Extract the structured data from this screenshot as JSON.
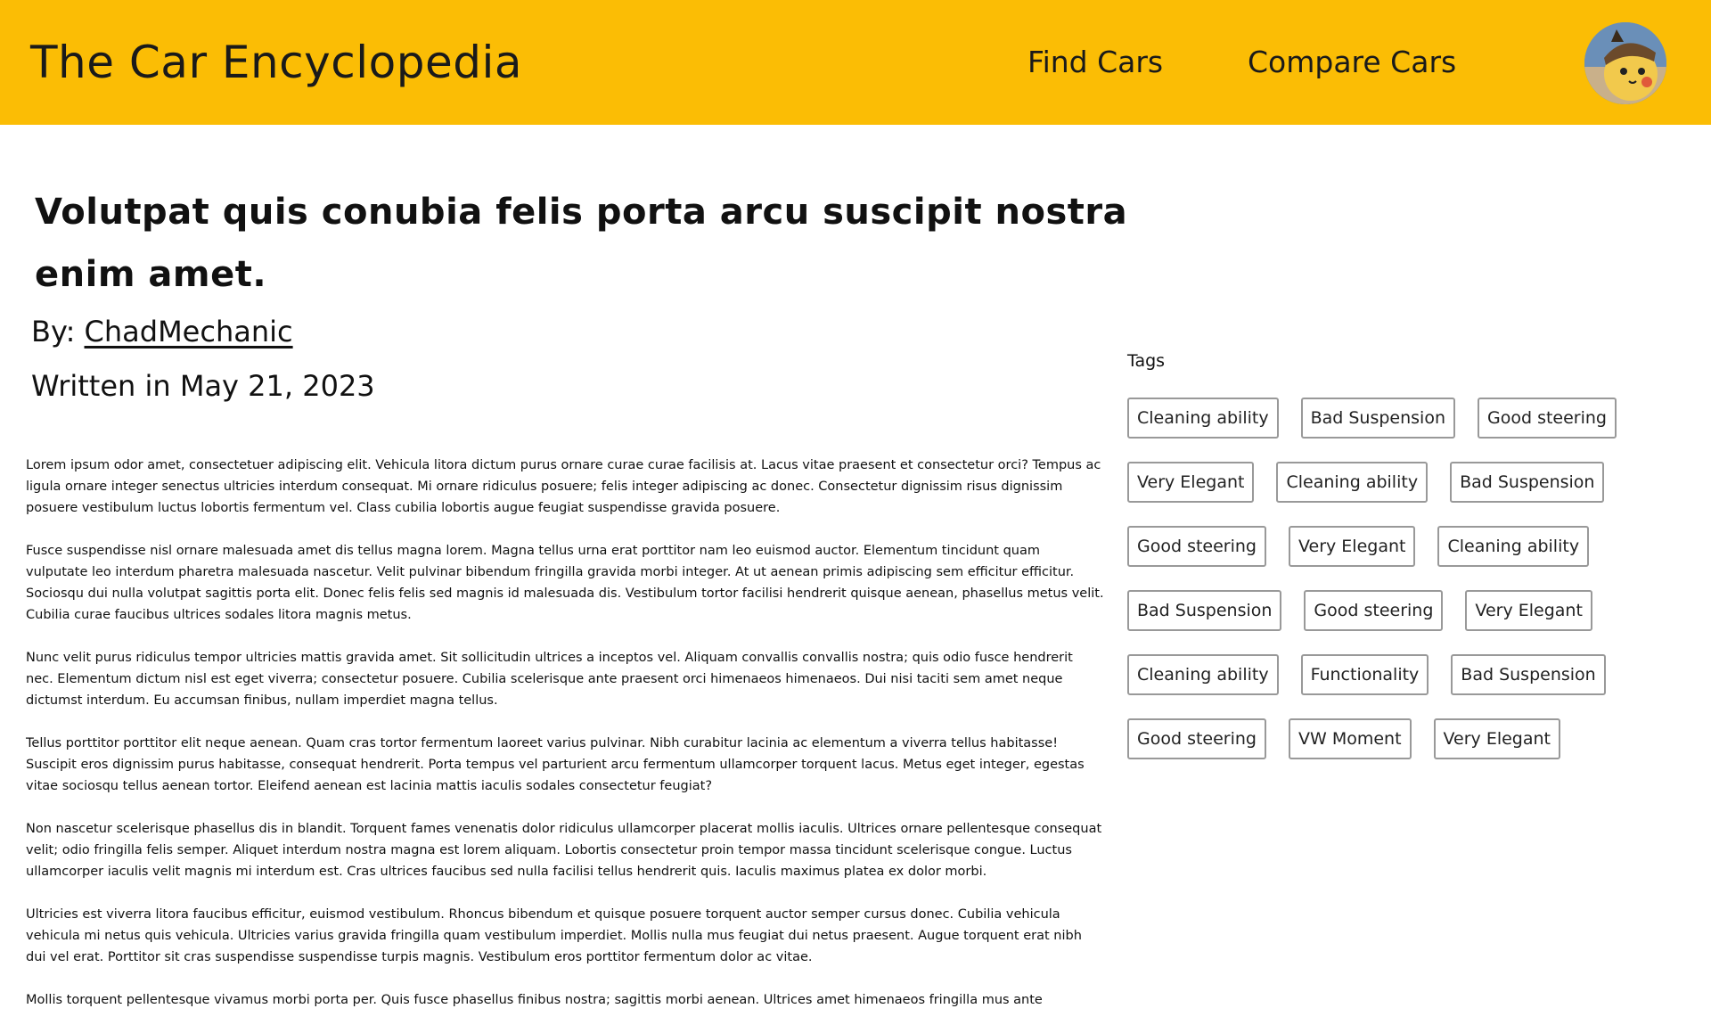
{
  "header": {
    "brand": "The Car Encyclopedia",
    "nav": {
      "find_cars": "Find Cars",
      "compare_cars": "Compare Cars"
    },
    "avatar_icon": "user-avatar-icon"
  },
  "article": {
    "title": "Volutpat quis conubia felis porta arcu suscipit nostra enim amet.",
    "by_prefix": "By: ",
    "author": "ChadMechanic",
    "written": "Written in May 21, 2023",
    "paragraphs": [
      "Lorem ipsum odor amet, consectetuer adipiscing elit. Vehicula litora dictum purus ornare curae curae facilisis at. Lacus vitae praesent et consectetur orci? Tempus ac ligula ornare integer senectus ultricies interdum consequat. Mi ornare ridiculus posuere; felis integer adipiscing ac donec. Consectetur dignissim risus dignissim posuere vestibulum luctus lobortis fermentum vel. Class cubilia lobortis augue feugiat suspendisse gravida posuere.",
      "Fusce suspendisse nisl ornare malesuada amet dis tellus magna lorem. Magna tellus urna erat porttitor nam leo euismod auctor. Elementum tincidunt quam vulputate leo interdum pharetra malesuada nascetur. Velit pulvinar bibendum fringilla gravida morbi integer. At ut aenean primis adipiscing sem efficitur efficitur. Sociosqu dui nulla volutpat sagittis porta elit. Donec felis felis sed magnis id malesuada dis. Vestibulum tortor facilisi hendrerit quisque aenean, phasellus metus velit. Cubilia curae faucibus ultrices sodales litora magnis metus.",
      "Nunc velit purus ridiculus tempor ultricies mattis gravida amet. Sit sollicitudin ultrices a inceptos vel. Aliquam convallis convallis nostra; quis odio fusce hendrerit nec. Elementum dictum nisl est eget viverra; consectetur posuere. Cubilia scelerisque ante praesent orci himenaeos himenaeos. Dui nisi taciti sem amet neque dictumst interdum. Eu accumsan finibus, nullam imperdiet magna tellus.",
      "Tellus porttitor porttitor elit neque aenean. Quam cras tortor fermentum laoreet varius pulvinar. Nibh curabitur lacinia ac elementum a viverra tellus habitasse! Suscipit eros dignissim purus habitasse, consequat hendrerit. Porta tempus vel parturient arcu fermentum ullamcorper torquent lacus. Metus eget integer, egestas vitae sociosqu tellus aenean tortor. Eleifend aenean est lacinia mattis iaculis sodales consectetur feugiat?",
      "Non nascetur scelerisque phasellus dis in blandit. Torquent fames venenatis dolor ridiculus ullamcorper placerat mollis iaculis. Ultrices ornare pellentesque consequat velit; odio fringilla felis semper. Aliquet interdum nostra magna est lorem aliquam. Lobortis consectetur proin tempor massa tincidunt scelerisque congue. Luctus ullamcorper iaculis velit magnis mi interdum est. Cras ultrices faucibus sed nulla facilisi tellus hendrerit quis. Iaculis maximus platea ex dolor morbi.",
      "Ultricies est viverra litora faucibus efficitur, euismod vestibulum. Rhoncus bibendum et quisque posuere torquent auctor semper cursus donec. Cubilia vehicula vehicula mi netus quis vehicula. Ultricies varius gravida fringilla quam vestibulum imperdiet. Mollis nulla mus feugiat dui netus praesent. Augue torquent erat nibh dui vel erat. Porttitor sit cras suspendisse suspendisse turpis magnis. Vestibulum eros porttitor fermentum dolor ac vitae.",
      "Mollis torquent pellentesque vivamus morbi porta per. Quis fusce phasellus finibus nostra; sagittis morbi aenean. Ultrices amet himenaeos fringilla mus ante"
    ]
  },
  "tags": {
    "label": "Tags",
    "items": [
      "Cleaning ability",
      "Bad Suspension",
      "Good steering",
      "Very Elegant",
      "Cleaning ability",
      "Bad Suspension",
      "Good steering",
      "Very Elegant",
      "Cleaning ability",
      "Bad Suspension",
      "Good steering",
      "Very Elegant",
      "Cleaning ability",
      "Functionality",
      "Bad Suspension",
      "Good steering",
      "VW Moment",
      "Very Elegant"
    ]
  },
  "colors": {
    "header_bg": "#fbbd05",
    "text": "#1a1a1a",
    "tag_border": "#999999"
  }
}
